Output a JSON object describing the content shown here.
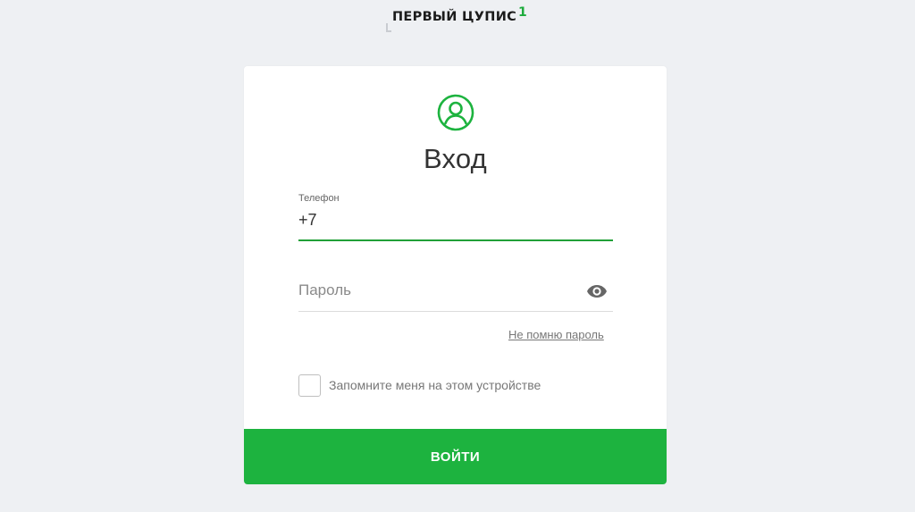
{
  "brand": {
    "name": "ПЕРВЫЙ ЦУПИС",
    "mark": "1",
    "accent_color": "#1db33f"
  },
  "icons": {
    "user": "user-circle-icon",
    "password_toggle": "eye-icon"
  },
  "login": {
    "title": "Вход",
    "phone": {
      "label": "Телефон",
      "value": "+7"
    },
    "password": {
      "placeholder": "Пароль"
    },
    "forgot_link": "Не помню пароль",
    "remember_label": "Запомните меня на этом устройстве",
    "remember_checked": false,
    "submit_label": "ВОЙТИ"
  }
}
